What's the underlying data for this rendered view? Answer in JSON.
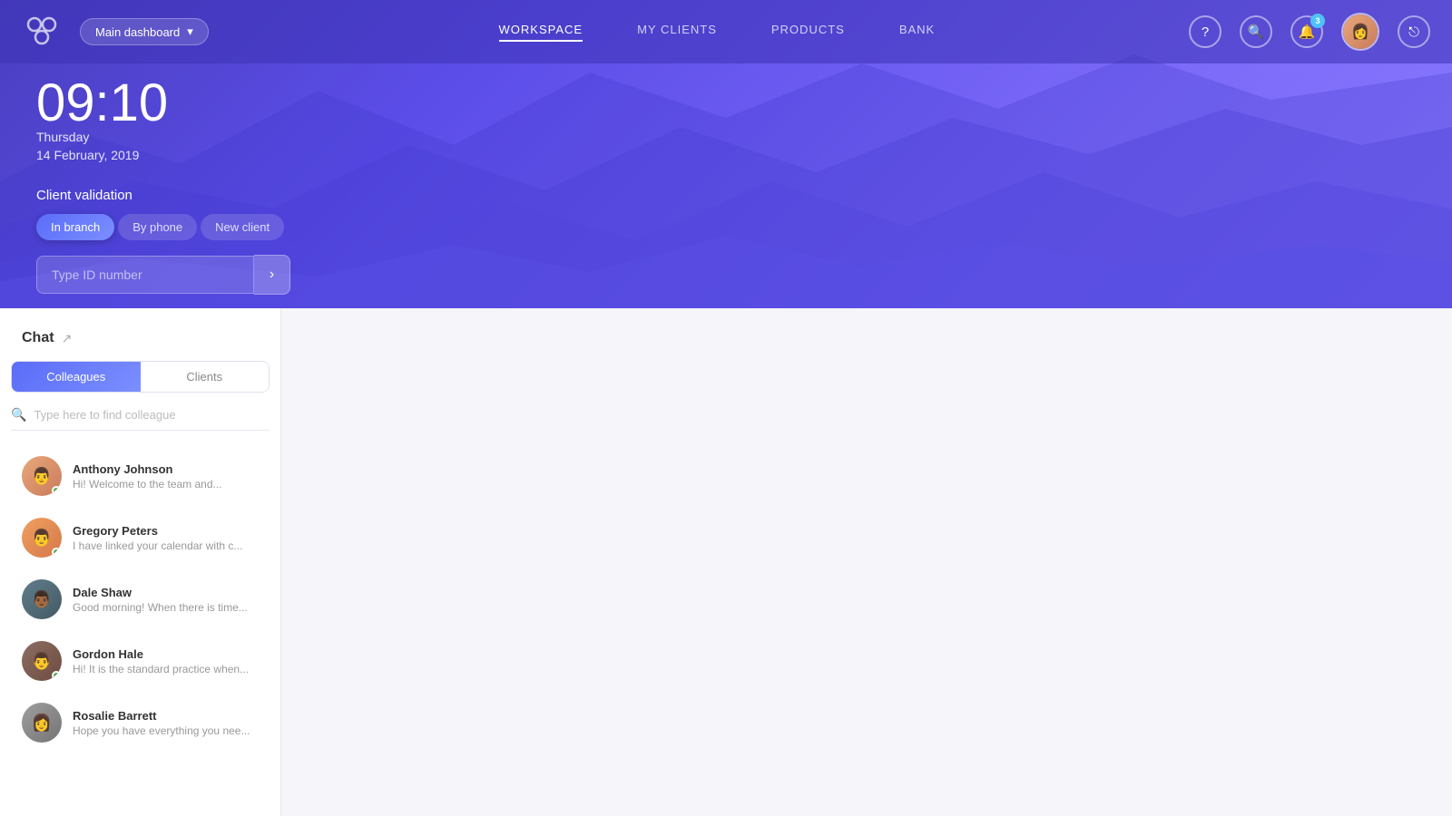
{
  "app": {
    "logo_label": "App Logo"
  },
  "topnav": {
    "dashboard_label": "Main dashboard",
    "nav_items": [
      {
        "id": "workspace",
        "label": "WORKSPACE",
        "active": true
      },
      {
        "id": "my-clients",
        "label": "MY CLIENTS",
        "active": false
      },
      {
        "id": "products",
        "label": "PRODUCTS",
        "active": false
      },
      {
        "id": "bank",
        "label": "BANK",
        "active": false
      }
    ],
    "help_icon": "?",
    "search_icon": "🔍",
    "notification_count": "3",
    "logout_icon": "→"
  },
  "hero": {
    "time": "09:10",
    "day": "Thursday",
    "date": "14 February, 2019",
    "client_validation_title": "Client validation",
    "validation_tabs": [
      {
        "id": "in-branch",
        "label": "In branch",
        "active": true
      },
      {
        "id": "by-phone",
        "label": "By phone",
        "active": false
      },
      {
        "id": "new-client",
        "label": "New client",
        "active": false
      }
    ],
    "id_placeholder": "Type ID number"
  },
  "chat": {
    "title": "Chat",
    "tabs": [
      {
        "id": "colleagues",
        "label": "Colleagues",
        "active": true
      },
      {
        "id": "clients",
        "label": "Clients",
        "active": false
      }
    ],
    "search_placeholder": "Type here to find colleague",
    "contacts": [
      {
        "id": 1,
        "name": "Anthony Johnson",
        "message": "Hi! Welcome to the team and...",
        "online": true,
        "color": "av-1"
      },
      {
        "id": 2,
        "name": "Gregory Peters",
        "message": "I have linked your calendar with c...",
        "online": true,
        "color": "av-2"
      },
      {
        "id": 3,
        "name": "Dale Shaw",
        "message": "Good morning! When there is time...",
        "online": false,
        "color": "av-3"
      },
      {
        "id": 4,
        "name": "Gordon Hale",
        "message": "Hi! It is the standard practice when...",
        "online": true,
        "color": "av-4"
      },
      {
        "id": 5,
        "name": "Rosalie Barrett",
        "message": "Hope you have everything you nee...",
        "online": false,
        "color": "av-5"
      }
    ]
  }
}
